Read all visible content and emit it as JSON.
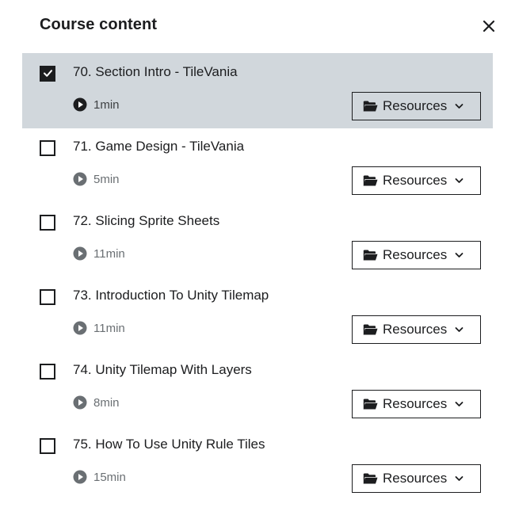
{
  "header": {
    "title": "Course content",
    "close_icon": "close-icon"
  },
  "items": [
    {
      "title": "70. Section Intro - TileVania",
      "duration": "1min",
      "checked": true,
      "active": true,
      "resources_label": "Resources"
    },
    {
      "title": "71. Game Design - TileVania",
      "duration": "5min",
      "checked": false,
      "active": false,
      "resources_label": "Resources"
    },
    {
      "title": "72. Slicing Sprite Sheets",
      "duration": "11min",
      "checked": false,
      "active": false,
      "resources_label": "Resources"
    },
    {
      "title": "73. Introduction To Unity Tilemap",
      "duration": "11min",
      "checked": false,
      "active": false,
      "resources_label": "Resources"
    },
    {
      "title": "74. Unity Tilemap With Layers",
      "duration": "8min",
      "checked": false,
      "active": false,
      "resources_label": "Resources"
    },
    {
      "title": "75. How To Use Unity Rule Tiles",
      "duration": "15min",
      "checked": false,
      "active": false,
      "resources_label": "Resources"
    }
  ],
  "icons": {
    "checkbox": "checkbox-icon",
    "check": "check-icon",
    "play": "play-circle-icon",
    "folder": "folder-open-icon",
    "chevron": "chevron-down-icon"
  },
  "colors": {
    "active_row_bg": "#d1d7dc",
    "text_primary": "#1c1d1f",
    "text_secondary": "#6a6f73",
    "play_icon_active": "#1c1d1f",
    "play_icon_default": "#6a6f73"
  }
}
